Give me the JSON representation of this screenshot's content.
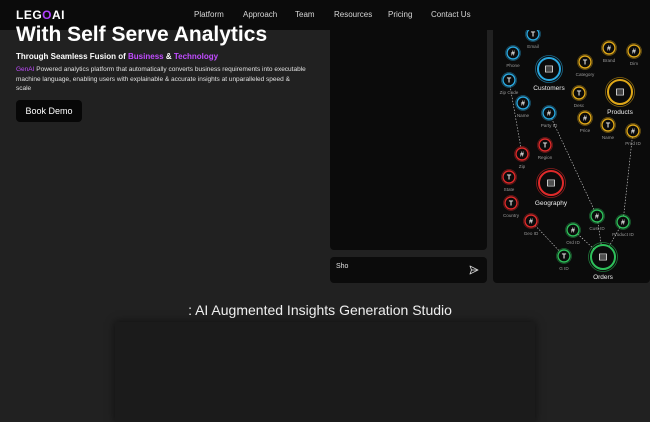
{
  "nav": {
    "logo_pre": "LEG",
    "logo_accent": "O",
    "logo_post": "AI",
    "links": [
      "Platform",
      "Approach",
      "Team",
      "Resources",
      "Pricing",
      "Contact Us"
    ]
  },
  "hero": {
    "title": "With Self Serve Analytics",
    "subtitle_pre": "Through Seamless Fusion of ",
    "subtitle_business": "Business",
    "subtitle_amp": " & ",
    "subtitle_tech": "Technology",
    "desc_genai": "GenAI",
    "desc_rest": " Powered analytics platform that automatically converts business requirements into executable machine language, enabling users with explainable & accurate insights at unparalleled speed & scale",
    "cta": "Book Demo"
  },
  "chat": {
    "input_value": "Sho"
  },
  "graph": {
    "entities": [
      "Customers",
      "Products",
      "Geography",
      "Orders"
    ],
    "fields": [
      "Email",
      "Phone",
      "Zip Code",
      "Name",
      "Party ID",
      "Category",
      "Brand",
      "Dim",
      "Desc",
      "Price",
      "Name",
      "Prod ID",
      "Zip",
      "Region",
      "State",
      "Country",
      "Geo ID",
      "Ord ID",
      "Cust ID",
      "Product ID",
      "G ID"
    ]
  },
  "studio": {
    "title": ": AI Augmented Insights Generation Studio"
  },
  "colors": {
    "accent": "#b040ff",
    "customers": "#2aa8e0",
    "products": "#e0a818",
    "geography": "#e02a2a",
    "orders": "#2ec05a"
  },
  "icons": [
    "send-icon",
    "table-icon",
    "text-field-icon",
    "number-field-icon"
  ]
}
